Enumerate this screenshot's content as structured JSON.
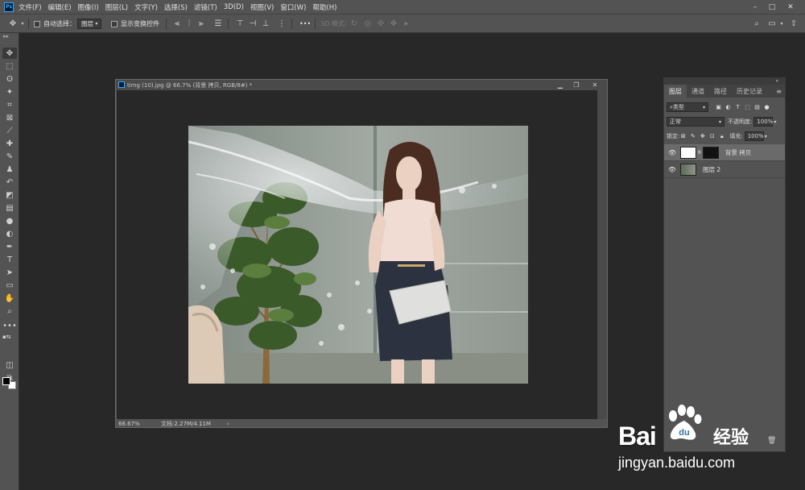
{
  "menubar": {
    "items": [
      "文件(F)",
      "编辑(E)",
      "图像(I)",
      "图层(L)",
      "文字(Y)",
      "选择(S)",
      "滤镜(T)",
      "3D(D)",
      "视图(V)",
      "窗口(W)",
      "帮助(H)"
    ],
    "logo": "Ps",
    "window_controls": {
      "minimize": "–",
      "maximize": "□",
      "close": "✕"
    }
  },
  "options": {
    "auto_select_label": "自动选择：",
    "auto_select_value": "图层",
    "show_transform_label": "显示变换控件",
    "mode3d_label": "3D 模式：",
    "more": "•••"
  },
  "document": {
    "title": "timg (10).jpg @ 66.7% (背景 拷贝, RGB/8#) *",
    "zoom": "66.67%",
    "doc_info": "文档:2.27M/4.11M",
    "arrow": "›"
  },
  "layers_panel": {
    "collapse": "«",
    "tabs": [
      "图层",
      "通道",
      "路径",
      "历史记录"
    ],
    "menu_icon": "≡",
    "filter_type": "类型",
    "blend_mode": "正常",
    "opacity_label": "不透明度:",
    "opacity_value": "100%",
    "lock_label": "锁定:",
    "fill_label": "填充:",
    "fill_value": "100%",
    "layers": [
      {
        "name": "背景 拷贝",
        "active": true
      },
      {
        "name": "图层 2",
        "active": false
      }
    ]
  },
  "watermark": {
    "brand": "Bai",
    "du": "du",
    "jingyan": "经验",
    "url": "jingyan.baidu.com"
  },
  "colors": {
    "ui_panel": "#535353",
    "workspace": "#282828",
    "accent": "#31a8ff"
  }
}
